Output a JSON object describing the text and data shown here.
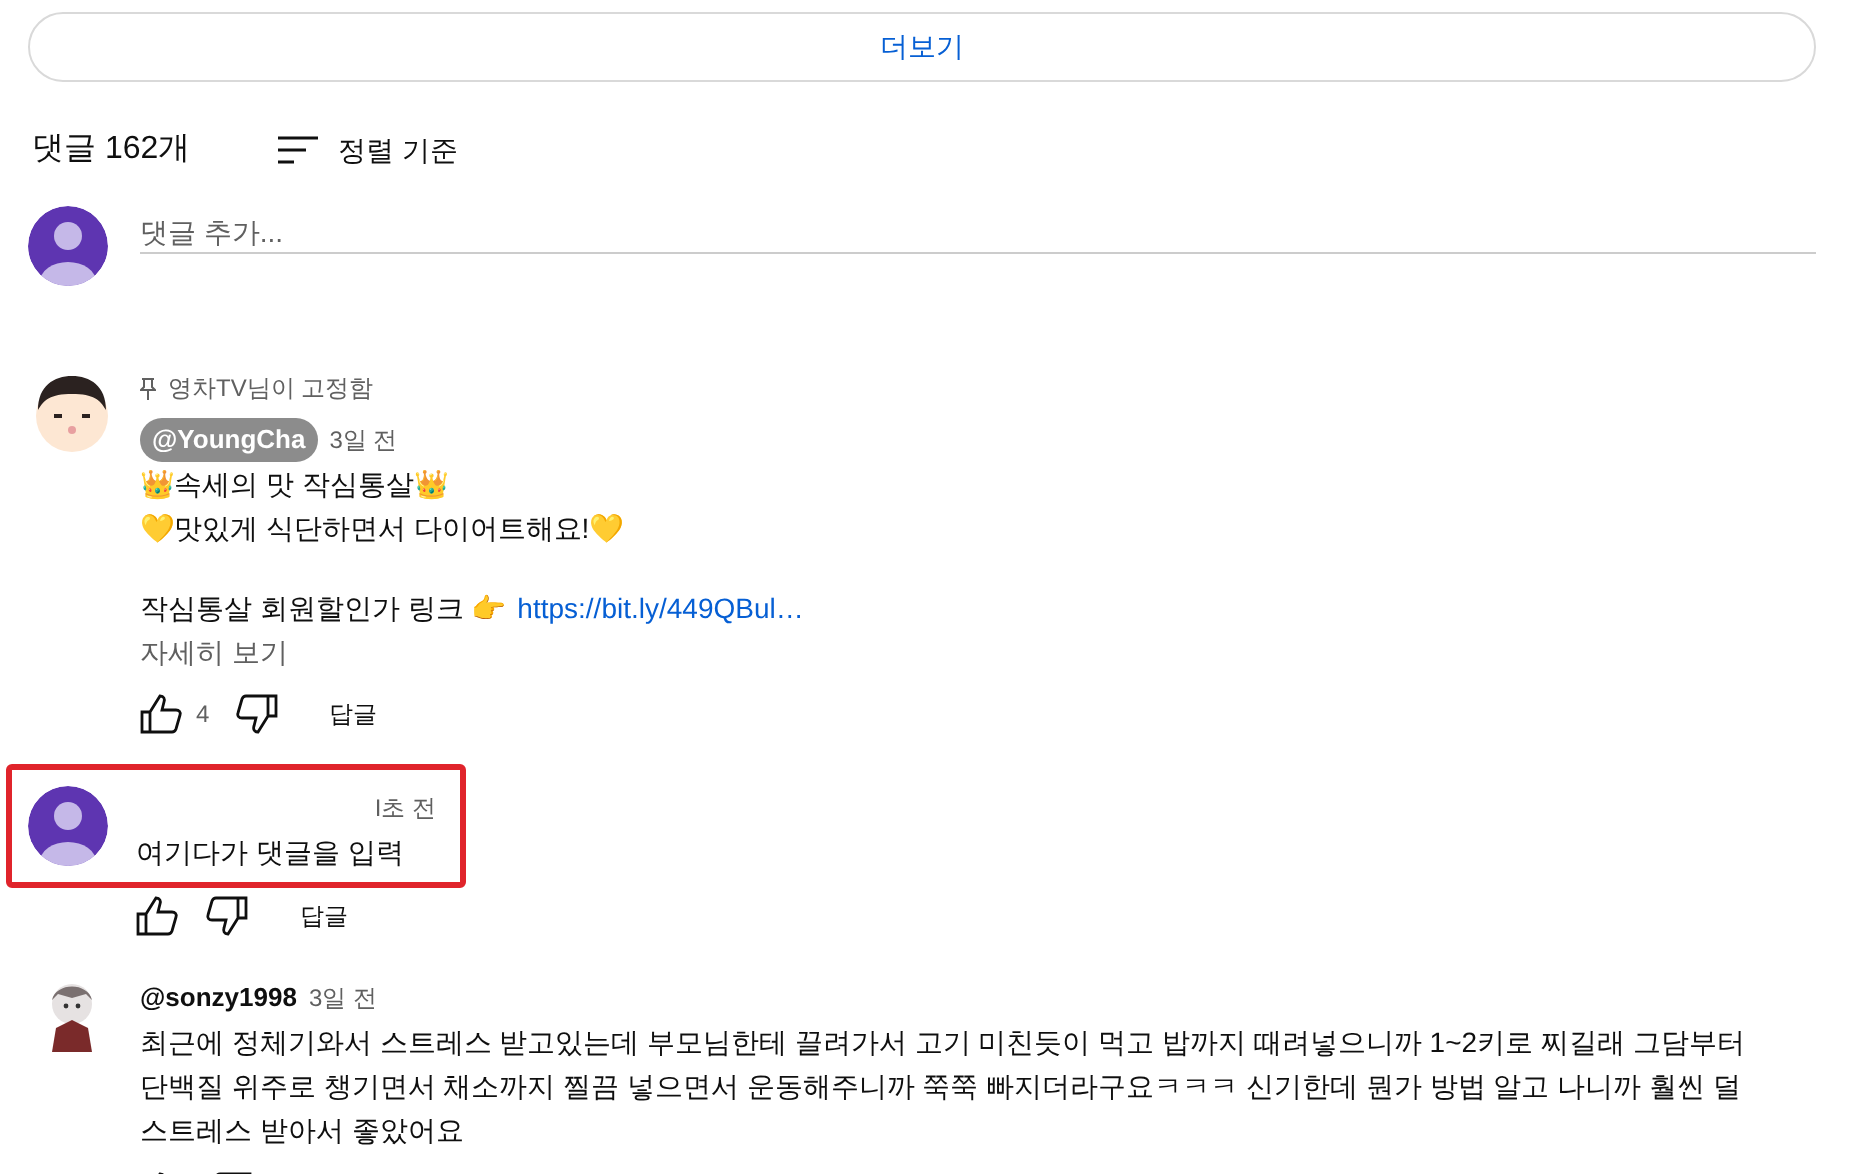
{
  "more_button": {
    "label": "더보기"
  },
  "comments_header": {
    "count": "댓글 162개",
    "sort_label": "정렬 기준"
  },
  "add_comment": {
    "placeholder": "댓글 추가..."
  },
  "comments": [
    {
      "kind": "pinned",
      "pinned_by": "영차TV님이 고정함",
      "author": "@YoungCha",
      "author_badge": true,
      "time": "3일 전",
      "paragraphs": [
        "👑속세의 맛 작심통살👑\n💛맛있게 식단하면서 다이어트해요!💛"
      ],
      "link_text": "작심통살 회원할인가 링크 👉",
      "link": "https://bit.ly/449QBul…",
      "read_more": "자세히 보기",
      "likes": "4",
      "reply": "답글"
    },
    {
      "kind": "own",
      "time": "I초 전",
      "paragraphs": [
        "여기다가 댓글을 입력"
      ],
      "reply": "답글"
    },
    {
      "kind": "user",
      "author": "@sonzy1998",
      "time": "3일 전",
      "paragraphs": [
        "최근에 정체기와서 스트레스 받고있는데 부모님한테 끌려가서 고기 미친듯이 먹고 밥까지 때려넣으니까 1~2키로 찌길래 그담부터 단백질 위주로 챙기면서 채소까지 찔끔 넣으면서 운동해주니까 쭉쭉 빠지더라구요ㅋㅋㅋ 신기한데 뭔가 방법 알고 나니까 훨씬 덜 스트레스 받아서 좋았어요"
      ]
    }
  ]
}
